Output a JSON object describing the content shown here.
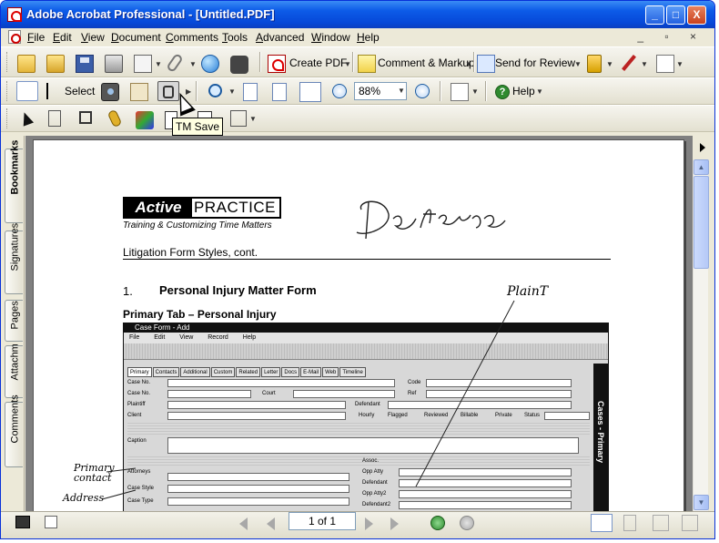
{
  "window": {
    "title": "Adobe Acrobat Professional - [Untitled.PDF]",
    "minimize": "_",
    "maximize": "□",
    "close": "X"
  },
  "menu": {
    "items": [
      {
        "label": "File",
        "u": "F",
        "rest": "ile"
      },
      {
        "label": "Edit",
        "u": "E",
        "rest": "dit"
      },
      {
        "label": "View",
        "u": "V",
        "rest": "iew"
      },
      {
        "label": "Document",
        "u": "D",
        "rest": "ocument"
      },
      {
        "label": "Comments",
        "u": "C",
        "rest": "omments"
      },
      {
        "label": "Tools",
        "u": "T",
        "rest": "ools"
      },
      {
        "label": "Advanced",
        "u": "A",
        "rest": "dvanced"
      },
      {
        "label": "Window",
        "u": "W",
        "rest": "indow"
      },
      {
        "label": "Help",
        "u": "H",
        "rest": "elp"
      }
    ],
    "mdi_controls": "_ ▫ ×"
  },
  "toolbar1": {
    "create_pdf": "Create PDF",
    "comment_markup": "Comment & Markup",
    "send_for_review": "Send for Review"
  },
  "toolbar2": {
    "select": "Select",
    "zoom_value": "88%",
    "help": "Help"
  },
  "tooltip": {
    "text": "TM Save"
  },
  "side_tabs": {
    "bookmarks": "Bookmarks",
    "signatures": "Signatures",
    "pages": "Pages",
    "attachments": "Attachm",
    "comments": "Comments"
  },
  "statusbar": {
    "page_indicator": "1 of 1"
  },
  "document": {
    "logo_active": "Active",
    "logo_practice": "PRACTICE",
    "logo_tagline": "Training & Customizing Time Matters",
    "handwritten_title": "Defense",
    "section_title": "Litigation Form Styles, cont.",
    "heading_number": "1.",
    "heading": "Personal Injury Matter Form",
    "subheading": "Primary Tab – Personal Injury",
    "handwritten_plaintiff": "PlainT",
    "handwritten_primary": "Primary",
    "handwritten_contact": "contact",
    "handwritten_address": "Address",
    "form": {
      "title": "Case Form - Add",
      "menu": [
        "File",
        "Edit",
        "View",
        "Record",
        "Help"
      ],
      "tabs": [
        "Primary",
        "Contacts",
        "Additional",
        "Custom",
        "Related",
        "Letter",
        "Docs",
        "E-Mail",
        "Web",
        "Timeline"
      ],
      "fields": [
        "Case No.",
        "Case No.",
        "Plaintiff",
        "Client",
        "Caption",
        "Attorneys",
        "Case Style",
        "Case Type"
      ],
      "labels_right": [
        "Code",
        "Defendant",
        "Status",
        "Court",
        "Ref"
      ],
      "labels_lower": [
        "Assoc.",
        "Opp Atty",
        "Defendant",
        "Opp Atty2",
        "Defendant2"
      ],
      "checkboxes": [
        "Hourly",
        "Flagged",
        "Reviewed",
        "Billable",
        "Private"
      ],
      "sidebar": "Cases - Primary"
    }
  }
}
